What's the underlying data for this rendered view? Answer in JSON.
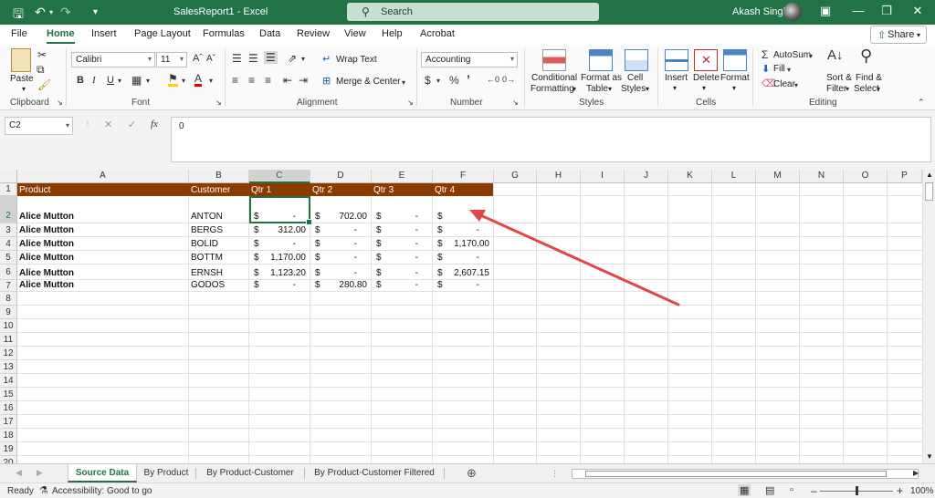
{
  "window": {
    "title": "SalesReport1  -  Excel",
    "search_placeholder": "Search",
    "user_name": "Akash Singh"
  },
  "menu": {
    "tabs": [
      "File",
      "Home",
      "Insert",
      "Page Layout",
      "Formulas",
      "Data",
      "Review",
      "View",
      "Help",
      "Acrobat"
    ],
    "active": "Home",
    "share_label": "Share"
  },
  "ribbon": {
    "clipboard": {
      "label": "Clipboard",
      "paste": "Paste"
    },
    "font": {
      "label": "Font",
      "name": "Calibri",
      "size": "11"
    },
    "alignment": {
      "label": "Alignment",
      "wrap_text": "Wrap Text",
      "merge_center": "Merge & Center"
    },
    "number": {
      "label": "Number",
      "format": "Accounting"
    },
    "styles": {
      "label": "Styles",
      "conditional_formatting_1": "Conditional",
      "conditional_formatting_2": "Formatting",
      "format_as_table_1": "Format as",
      "format_as_table_2": "Table",
      "cell_styles_1": "Cell",
      "cell_styles_2": "Styles"
    },
    "cells": {
      "label": "Cells",
      "insert": "Insert",
      "delete": "Delete",
      "format": "Format"
    },
    "editing": {
      "label": "Editing",
      "autosum": "AutoSum",
      "fill": "Fill",
      "clear": "Clear",
      "sort_filter_1": "Sort &",
      "sort_filter_2": "Filter",
      "find_select_1": "Find &",
      "find_select_2": "Select"
    }
  },
  "formula_bar": {
    "name_box": "C2",
    "fx": "fx",
    "value": "0"
  },
  "grid": {
    "columns": [
      "A",
      "B",
      "C",
      "D",
      "E",
      "F",
      "G",
      "H",
      "I",
      "J",
      "K",
      "L",
      "M",
      "N",
      "O",
      "P"
    ],
    "rows": [
      "1",
      "2",
      "3",
      "4",
      "5",
      "6",
      "7",
      "8",
      "9",
      "10",
      "11",
      "12",
      "13",
      "14",
      "15",
      "16",
      "17",
      "18",
      "19",
      "20"
    ],
    "header_row": [
      "Product",
      "Customer",
      "Qtr 1",
      "Qtr 2",
      "Qtr 3",
      "Qtr 4"
    ],
    "data_rows": [
      {
        "product": "Alice Mutton",
        "customer": "ANTON",
        "q1": "-",
        "q2": "702.00",
        "q3": "-",
        "q4": ""
      },
      {
        "product": "Alice Mutton",
        "customer": "BERGS",
        "q1": "312.00",
        "q2": "-",
        "q3": "-",
        "q4": "-"
      },
      {
        "product": "Alice Mutton",
        "customer": "BOLID",
        "q1": "-",
        "q2": "-",
        "q3": "-",
        "q4": "1,170.00"
      },
      {
        "product": "Alice Mutton",
        "customer": "BOTTM",
        "q1": "1,170.00",
        "q2": "-",
        "q3": "-",
        "q4": "-"
      },
      {
        "product": "Alice Mutton",
        "customer": "ERNSH",
        "q1": "1,123.20",
        "q2": "-",
        "q3": "-",
        "q4": "2,607.15"
      },
      {
        "product": "Alice Mutton",
        "customer": "GODOS",
        "q1": "-",
        "q2": "280.80",
        "q3": "-",
        "q4": "-"
      }
    ],
    "currency_symbol": "$",
    "header_color": "#8b3a00",
    "selected_cell": "C2"
  },
  "sheets": {
    "tabs": [
      "Source Data",
      "By Product",
      "By Product-Customer",
      "By Product-Customer Filtered"
    ],
    "active": "Source Data"
  },
  "status": {
    "ready": "Ready",
    "accessibility": "Accessibility: Good to go",
    "zoom": "100%"
  },
  "accent_color": "#217346"
}
